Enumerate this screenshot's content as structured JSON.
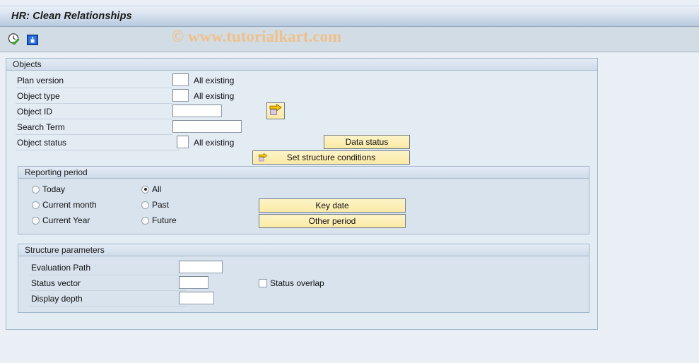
{
  "window": {
    "title": "HR: Clean Relationships"
  },
  "watermark": {
    "text": "© www.tutorialkart.com"
  },
  "toolbar": {
    "items": [
      {
        "name": "execute-icon",
        "tooltip": "Execute"
      },
      {
        "name": "info-icon",
        "tooltip": "Information"
      }
    ]
  },
  "objects": {
    "group_title": "Objects",
    "fields": [
      {
        "label": "Plan version",
        "value": "",
        "hint": "All existing"
      },
      {
        "label": "Object type",
        "value": "",
        "hint": "All existing"
      },
      {
        "label": "Object ID",
        "value": "",
        "hint": ""
      },
      {
        "label": "Search Term",
        "value": "",
        "hint": ""
      },
      {
        "label": "Object status",
        "value": "",
        "hint": "All existing"
      }
    ],
    "buttons": {
      "multiple_selection": "",
      "data_status": "Data status",
      "set_structure_conditions": "Set structure conditions"
    }
  },
  "reporting_period": {
    "group_title": "Reporting period",
    "options_left": [
      {
        "label": "Today",
        "selected": false
      },
      {
        "label": "Current month",
        "selected": false
      },
      {
        "label": "Current Year",
        "selected": false
      }
    ],
    "options_right": [
      {
        "label": "All",
        "selected": true
      },
      {
        "label": "Past",
        "selected": false
      },
      {
        "label": "Future",
        "selected": false
      }
    ],
    "buttons": {
      "key_date": "Key date",
      "other_period": "Other period"
    }
  },
  "structure_parameters": {
    "group_title": "Structure parameters",
    "fields": [
      {
        "label": "Evaluation Path",
        "value": ""
      },
      {
        "label": "Status vector",
        "value": ""
      },
      {
        "label": "Display depth",
        "value": ""
      }
    ],
    "checkbox": {
      "label": "Status overlap",
      "checked": false
    }
  },
  "colors": {
    "title_bar_bottom": "#b8cadf",
    "toolbar_bg": "#d2dce4",
    "page_bg": "#eaeff5",
    "group_bg": "#e3ebf3",
    "subgroup_bg": "#d8e3ee",
    "button_yellow": "#fbeaa6",
    "watermark": "#f0c08a"
  }
}
